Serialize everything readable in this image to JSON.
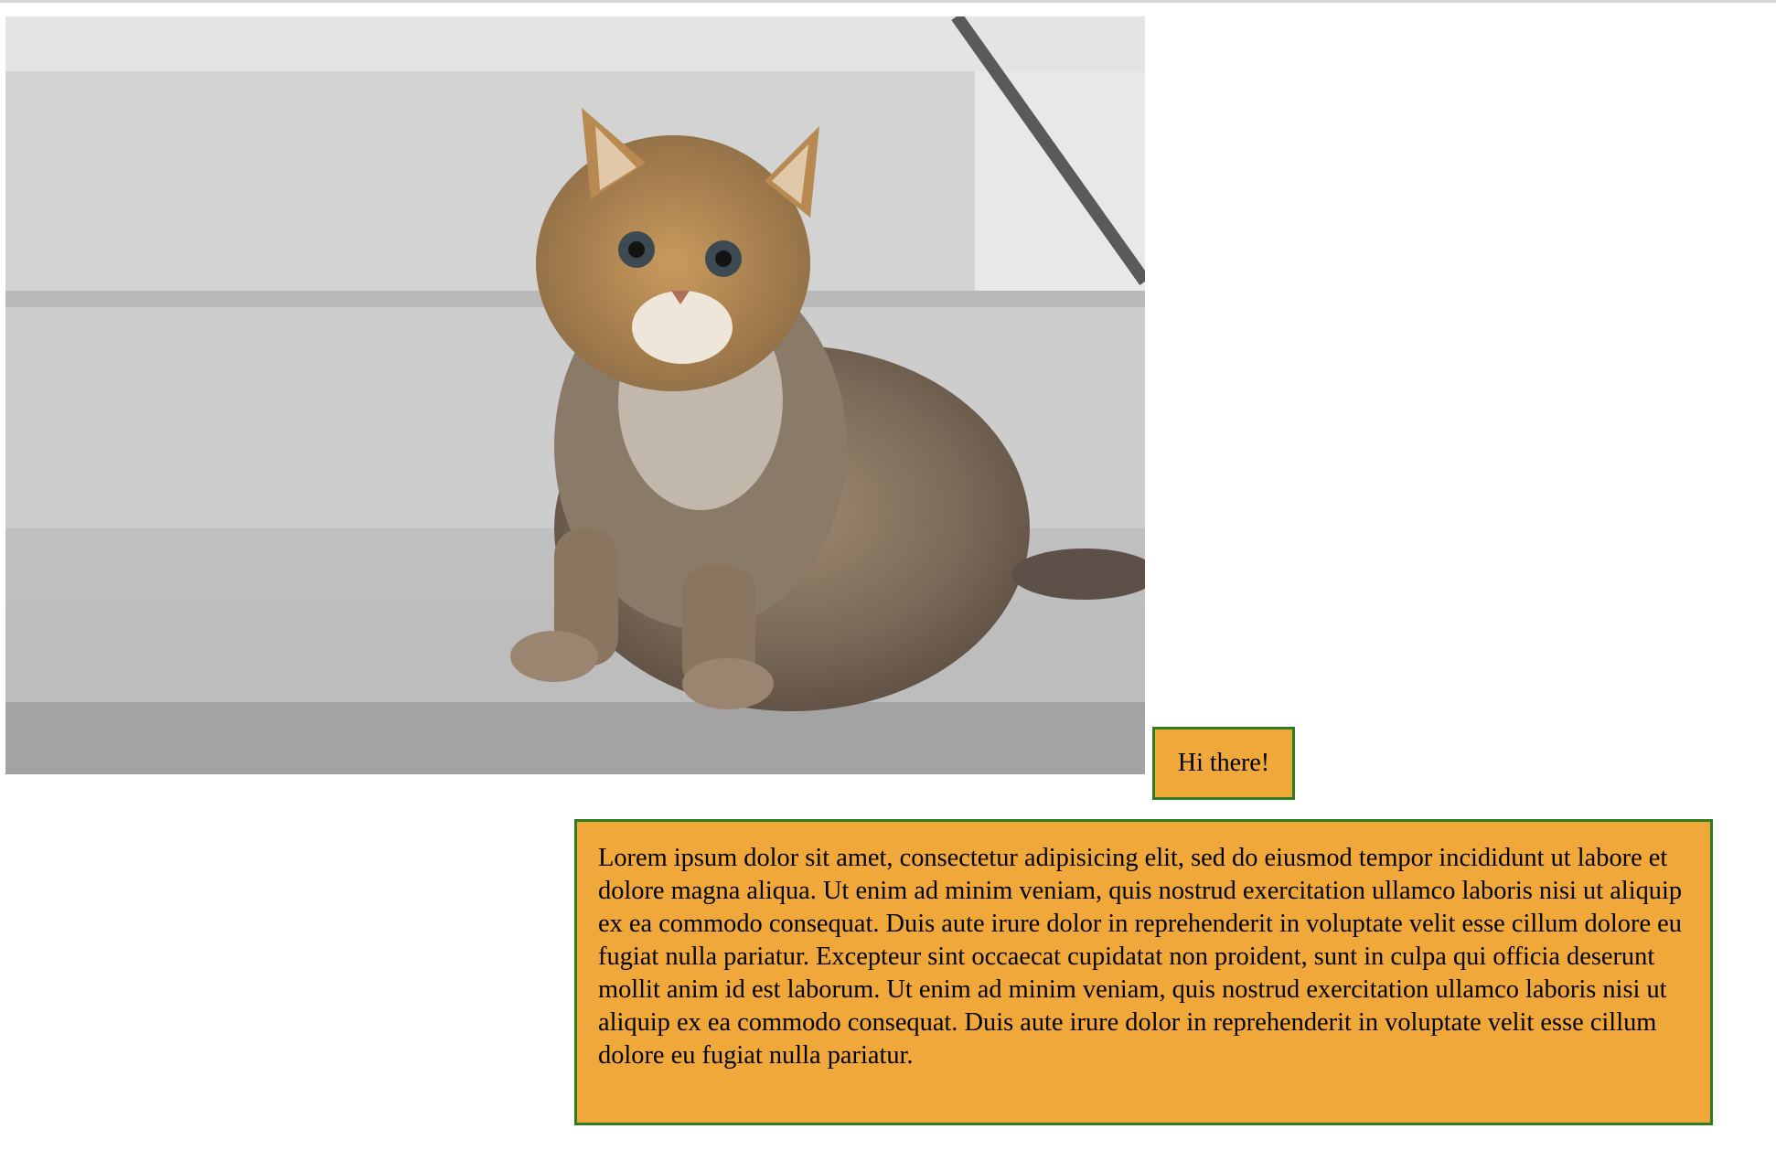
{
  "image": {
    "alt": "Fluffy tabby kitten sitting on grey stone steps"
  },
  "greeting": {
    "text": "Hi there!"
  },
  "paragraph": {
    "text": "Lorem ipsum dolor sit amet, consectetur adipisicing elit, sed do eiusmod tempor incididunt ut labore et dolore magna aliqua. Ut enim ad minim veniam, quis nostrud exercitation ullamco laboris nisi ut aliquip ex ea commodo consequat. Duis aute irure dolor in reprehenderit in voluptate velit esse cillum dolore eu fugiat nulla pariatur. Excepteur sint occaecat cupidatat non proident, sunt in culpa qui officia deserunt mollit anim id est laborum. Ut enim ad minim veniam, quis nostrud exercitation ullamco laboris nisi ut aliquip ex ea commodo consequat. Duis aute irure dolor in reprehenderit in voluptate velit esse cillum dolore eu fugiat nulla pariatur."
  },
  "colors": {
    "box_fill": "#f0a83a",
    "box_border": "#2f7d1f"
  }
}
